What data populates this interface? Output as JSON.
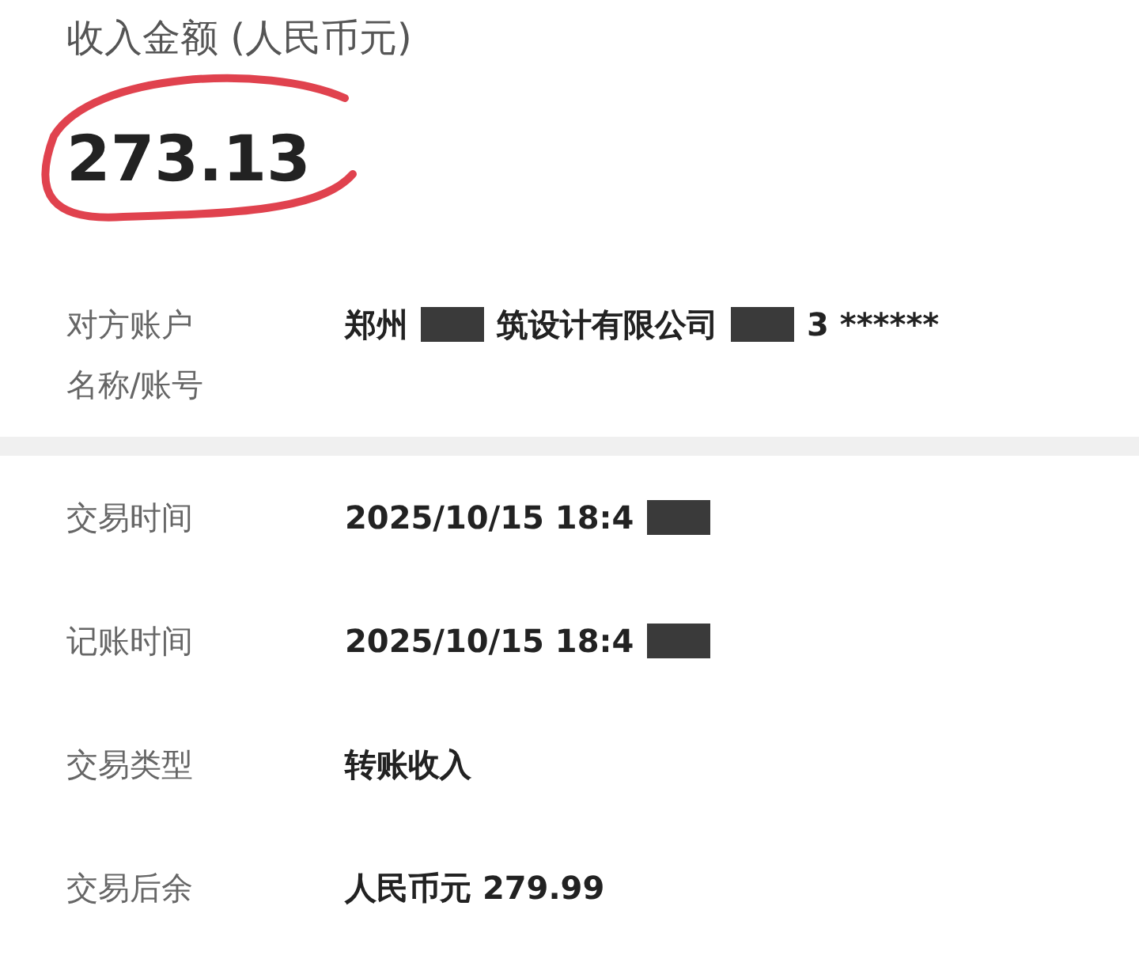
{
  "header": {
    "label": "收入金额 (人民币元)",
    "amount": "273.13"
  },
  "account": {
    "label": "对方账户名称/账号",
    "value": [
      {
        "text": "郑州",
        "redacted_after": true
      },
      {
        "text": "筑设计有限公司",
        "redacted_after": true
      },
      {
        "text": "3 ******",
        "redacted_after": false
      }
    ]
  },
  "details": [
    {
      "label": "交易时间",
      "value": [
        {
          "text": "2025/10/15 18:4",
          "redacted_after": true
        }
      ]
    },
    {
      "label": "记账时间",
      "value": [
        {
          "text": "2025/10/15 18:4",
          "redacted_after": true
        }
      ]
    },
    {
      "label": "交易类型",
      "value": [
        {
          "text": "转账收入",
          "redacted_after": false
        }
      ]
    },
    {
      "label": "交易后余",
      "value": [
        {
          "text": "人民币元 279.99",
          "redacted_after": false
        }
      ]
    }
  ]
}
